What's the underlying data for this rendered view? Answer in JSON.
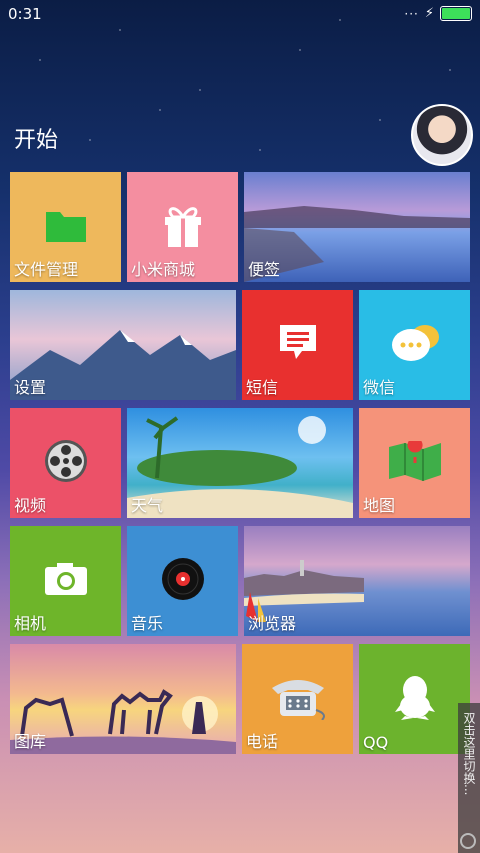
{
  "status": {
    "time": "0:31",
    "dots": "···"
  },
  "header": {
    "title": "开始"
  },
  "tiles": [
    {
      "label": "文件管理",
      "icon": "folder-icon",
      "color": "#eeb85c"
    },
    {
      "label": "小米商城",
      "icon": "gift-icon",
      "color": "#f48ea0"
    },
    {
      "label": "便签",
      "icon": "lake-photo"
    },
    {
      "label": "设置",
      "icon": "mountain-photo"
    },
    {
      "label": "短信",
      "icon": "message-icon",
      "color": "#e8302f"
    },
    {
      "label": "微信",
      "icon": "wechat-icon",
      "color": "#29bde6"
    },
    {
      "label": "视频",
      "icon": "film-reel-icon",
      "color": "#ec5168"
    },
    {
      "label": "天气",
      "icon": "beach-photo"
    },
    {
      "label": "地图",
      "icon": "map-icon",
      "color": "#f5937a"
    },
    {
      "label": "相机",
      "icon": "camera-icon",
      "color": "#6eb52a"
    },
    {
      "label": "音乐",
      "icon": "vinyl-record-icon",
      "color": "#3d8fd3"
    },
    {
      "label": "浏览器",
      "icon": "harbor-photo"
    },
    {
      "label": "图库",
      "icon": "desert-photo"
    },
    {
      "label": "电话",
      "icon": "telephone-icon",
      "color": "#eea13c"
    },
    {
      "label": "QQ",
      "icon": "qq-penguin-icon",
      "color": "#6cb32d"
    }
  ],
  "side_panel": {
    "text": "双击这里切换..."
  }
}
